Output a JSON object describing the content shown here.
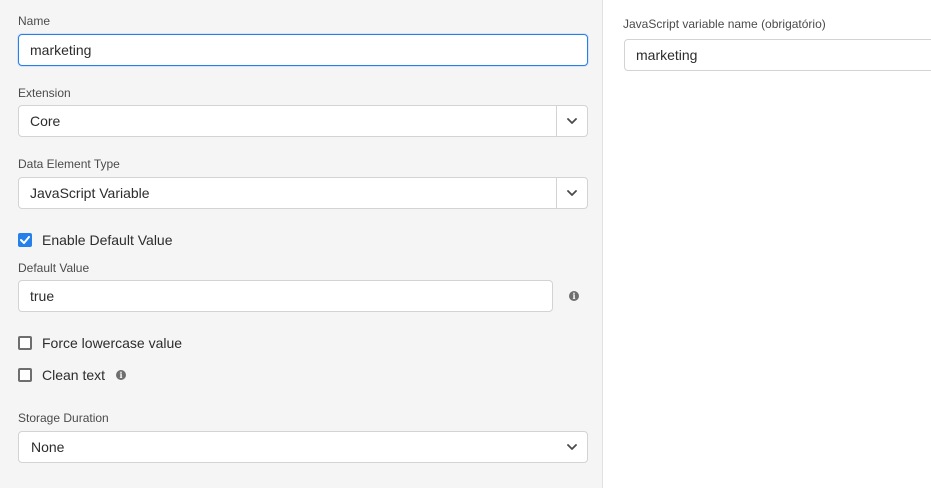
{
  "form": {
    "name_label": "Name",
    "name_value": "marketing",
    "extension_label": "Extension",
    "extension_value": "Core",
    "type_label": "Data Element Type",
    "type_value": "JavaScript Variable",
    "enable_default_label": "Enable Default Value",
    "enable_default_checked": true,
    "default_value_label": "Default Value",
    "default_value": "true",
    "force_lowercase_label": "Force lowercase value",
    "force_lowercase_checked": false,
    "clean_text_label": "Clean text",
    "clean_text_checked": false,
    "storage_label": "Storage Duration",
    "storage_value": "None"
  },
  "settings": {
    "var_label": "JavaScript variable name (obrigatório)",
    "var_value": "marketing"
  },
  "icons": {
    "info": "info-icon",
    "chevron": "chevron-down-icon",
    "check": "checkmark-icon"
  },
  "colors": {
    "accent": "#2680eb",
    "panel": "#f5f5f5"
  }
}
